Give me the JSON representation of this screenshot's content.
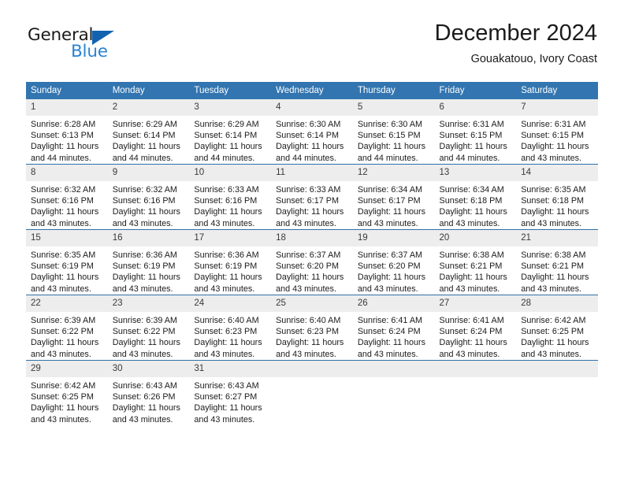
{
  "brand": {
    "name_part1": "General",
    "name_part2": "Blue",
    "triangle_icon": "triangle-icon",
    "accent_color": "#2b83d4",
    "triangle_color": "#1163b0"
  },
  "header": {
    "title": "December 2024",
    "subtitle": "Gouakatouo, Ivory Coast"
  },
  "theme": {
    "header_bg": "#3275b0",
    "header_text": "#ffffff",
    "daynum_bg": "#ededed",
    "week_separator": "#2f6fa8",
    "cell_bg": "#ffffff"
  },
  "weekday_headers": [
    "Sunday",
    "Monday",
    "Tuesday",
    "Wednesday",
    "Thursday",
    "Friday",
    "Saturday"
  ],
  "weeks": [
    [
      {
        "day": "1",
        "sunrise": "Sunrise: 6:28 AM",
        "sunset": "Sunset: 6:13 PM",
        "daylight_line1": "Daylight: 11 hours",
        "daylight_line2": "and 44 minutes."
      },
      {
        "day": "2",
        "sunrise": "Sunrise: 6:29 AM",
        "sunset": "Sunset: 6:14 PM",
        "daylight_line1": "Daylight: 11 hours",
        "daylight_line2": "and 44 minutes."
      },
      {
        "day": "3",
        "sunrise": "Sunrise: 6:29 AM",
        "sunset": "Sunset: 6:14 PM",
        "daylight_line1": "Daylight: 11 hours",
        "daylight_line2": "and 44 minutes."
      },
      {
        "day": "4",
        "sunrise": "Sunrise: 6:30 AM",
        "sunset": "Sunset: 6:14 PM",
        "daylight_line1": "Daylight: 11 hours",
        "daylight_line2": "and 44 minutes."
      },
      {
        "day": "5",
        "sunrise": "Sunrise: 6:30 AM",
        "sunset": "Sunset: 6:15 PM",
        "daylight_line1": "Daylight: 11 hours",
        "daylight_line2": "and 44 minutes."
      },
      {
        "day": "6",
        "sunrise": "Sunrise: 6:31 AM",
        "sunset": "Sunset: 6:15 PM",
        "daylight_line1": "Daylight: 11 hours",
        "daylight_line2": "and 44 minutes."
      },
      {
        "day": "7",
        "sunrise": "Sunrise: 6:31 AM",
        "sunset": "Sunset: 6:15 PM",
        "daylight_line1": "Daylight: 11 hours",
        "daylight_line2": "and 43 minutes."
      }
    ],
    [
      {
        "day": "8",
        "sunrise": "Sunrise: 6:32 AM",
        "sunset": "Sunset: 6:16 PM",
        "daylight_line1": "Daylight: 11 hours",
        "daylight_line2": "and 43 minutes."
      },
      {
        "day": "9",
        "sunrise": "Sunrise: 6:32 AM",
        "sunset": "Sunset: 6:16 PM",
        "daylight_line1": "Daylight: 11 hours",
        "daylight_line2": "and 43 minutes."
      },
      {
        "day": "10",
        "sunrise": "Sunrise: 6:33 AM",
        "sunset": "Sunset: 6:16 PM",
        "daylight_line1": "Daylight: 11 hours",
        "daylight_line2": "and 43 minutes."
      },
      {
        "day": "11",
        "sunrise": "Sunrise: 6:33 AM",
        "sunset": "Sunset: 6:17 PM",
        "daylight_line1": "Daylight: 11 hours",
        "daylight_line2": "and 43 minutes."
      },
      {
        "day": "12",
        "sunrise": "Sunrise: 6:34 AM",
        "sunset": "Sunset: 6:17 PM",
        "daylight_line1": "Daylight: 11 hours",
        "daylight_line2": "and 43 minutes."
      },
      {
        "day": "13",
        "sunrise": "Sunrise: 6:34 AM",
        "sunset": "Sunset: 6:18 PM",
        "daylight_line1": "Daylight: 11 hours",
        "daylight_line2": "and 43 minutes."
      },
      {
        "day": "14",
        "sunrise": "Sunrise: 6:35 AM",
        "sunset": "Sunset: 6:18 PM",
        "daylight_line1": "Daylight: 11 hours",
        "daylight_line2": "and 43 minutes."
      }
    ],
    [
      {
        "day": "15",
        "sunrise": "Sunrise: 6:35 AM",
        "sunset": "Sunset: 6:19 PM",
        "daylight_line1": "Daylight: 11 hours",
        "daylight_line2": "and 43 minutes."
      },
      {
        "day": "16",
        "sunrise": "Sunrise: 6:36 AM",
        "sunset": "Sunset: 6:19 PM",
        "daylight_line1": "Daylight: 11 hours",
        "daylight_line2": "and 43 minutes."
      },
      {
        "day": "17",
        "sunrise": "Sunrise: 6:36 AM",
        "sunset": "Sunset: 6:19 PM",
        "daylight_line1": "Daylight: 11 hours",
        "daylight_line2": "and 43 minutes."
      },
      {
        "day": "18",
        "sunrise": "Sunrise: 6:37 AM",
        "sunset": "Sunset: 6:20 PM",
        "daylight_line1": "Daylight: 11 hours",
        "daylight_line2": "and 43 minutes."
      },
      {
        "day": "19",
        "sunrise": "Sunrise: 6:37 AM",
        "sunset": "Sunset: 6:20 PM",
        "daylight_line1": "Daylight: 11 hours",
        "daylight_line2": "and 43 minutes."
      },
      {
        "day": "20",
        "sunrise": "Sunrise: 6:38 AM",
        "sunset": "Sunset: 6:21 PM",
        "daylight_line1": "Daylight: 11 hours",
        "daylight_line2": "and 43 minutes."
      },
      {
        "day": "21",
        "sunrise": "Sunrise: 6:38 AM",
        "sunset": "Sunset: 6:21 PM",
        "daylight_line1": "Daylight: 11 hours",
        "daylight_line2": "and 43 minutes."
      }
    ],
    [
      {
        "day": "22",
        "sunrise": "Sunrise: 6:39 AM",
        "sunset": "Sunset: 6:22 PM",
        "daylight_line1": "Daylight: 11 hours",
        "daylight_line2": "and 43 minutes."
      },
      {
        "day": "23",
        "sunrise": "Sunrise: 6:39 AM",
        "sunset": "Sunset: 6:22 PM",
        "daylight_line1": "Daylight: 11 hours",
        "daylight_line2": "and 43 minutes."
      },
      {
        "day": "24",
        "sunrise": "Sunrise: 6:40 AM",
        "sunset": "Sunset: 6:23 PM",
        "daylight_line1": "Daylight: 11 hours",
        "daylight_line2": "and 43 minutes."
      },
      {
        "day": "25",
        "sunrise": "Sunrise: 6:40 AM",
        "sunset": "Sunset: 6:23 PM",
        "daylight_line1": "Daylight: 11 hours",
        "daylight_line2": "and 43 minutes."
      },
      {
        "day": "26",
        "sunrise": "Sunrise: 6:41 AM",
        "sunset": "Sunset: 6:24 PM",
        "daylight_line1": "Daylight: 11 hours",
        "daylight_line2": "and 43 minutes."
      },
      {
        "day": "27",
        "sunrise": "Sunrise: 6:41 AM",
        "sunset": "Sunset: 6:24 PM",
        "daylight_line1": "Daylight: 11 hours",
        "daylight_line2": "and 43 minutes."
      },
      {
        "day": "28",
        "sunrise": "Sunrise: 6:42 AM",
        "sunset": "Sunset: 6:25 PM",
        "daylight_line1": "Daylight: 11 hours",
        "daylight_line2": "and 43 minutes."
      }
    ],
    [
      {
        "day": "29",
        "sunrise": "Sunrise: 6:42 AM",
        "sunset": "Sunset: 6:25 PM",
        "daylight_line1": "Daylight: 11 hours",
        "daylight_line2": "and 43 minutes."
      },
      {
        "day": "30",
        "sunrise": "Sunrise: 6:43 AM",
        "sunset": "Sunset: 6:26 PM",
        "daylight_line1": "Daylight: 11 hours",
        "daylight_line2": "and 43 minutes."
      },
      {
        "day": "31",
        "sunrise": "Sunrise: 6:43 AM",
        "sunset": "Sunset: 6:27 PM",
        "daylight_line1": "Daylight: 11 hours",
        "daylight_line2": "and 43 minutes."
      },
      {
        "day": "",
        "sunrise": "",
        "sunset": "",
        "daylight_line1": "",
        "daylight_line2": ""
      },
      {
        "day": "",
        "sunrise": "",
        "sunset": "",
        "daylight_line1": "",
        "daylight_line2": ""
      },
      {
        "day": "",
        "sunrise": "",
        "sunset": "",
        "daylight_line1": "",
        "daylight_line2": ""
      },
      {
        "day": "",
        "sunrise": "",
        "sunset": "",
        "daylight_line1": "",
        "daylight_line2": ""
      }
    ]
  ]
}
